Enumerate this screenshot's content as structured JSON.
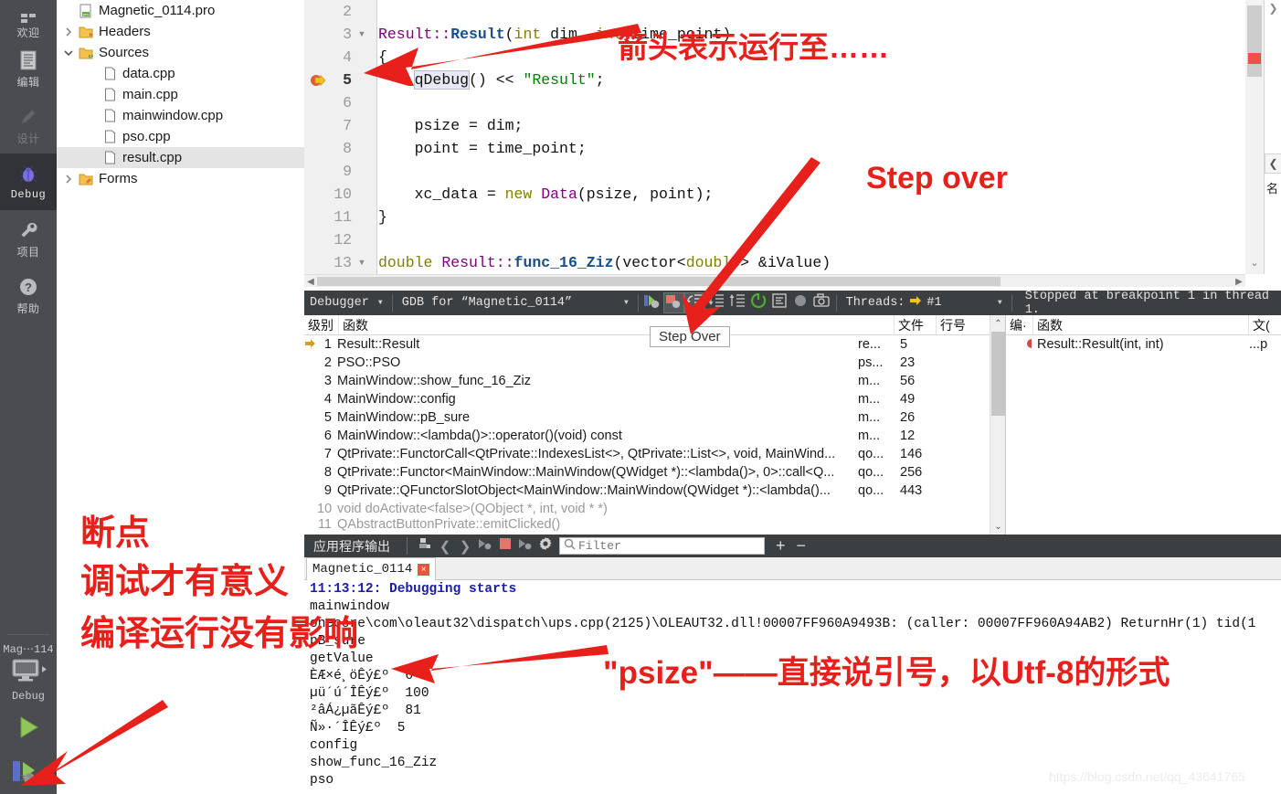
{
  "modebar": {
    "items": [
      {
        "label": "欢迎",
        "icon": "welcome-icon",
        "state": "normal"
      },
      {
        "label": "编辑",
        "icon": "edit-document-icon",
        "state": "normal"
      },
      {
        "label": "设计",
        "icon": "pencil-design-icon",
        "state": "disabled"
      },
      {
        "label": "Debug",
        "icon": "bug-icon",
        "state": "active"
      },
      {
        "label": "项目",
        "icon": "wrench-icon",
        "state": "normal"
      },
      {
        "label": "帮助",
        "icon": "question-help-icon",
        "state": "normal"
      }
    ],
    "kit_name": "Mag⋯114",
    "kit_config": "Debug",
    "run_button": "run-icon",
    "debug_button": "start-debugging-icon"
  },
  "tree": {
    "items": [
      {
        "label": "Magnetic_0114.pro",
        "indent": 1,
        "twisty": "",
        "icon": "pro-file-icon",
        "selected": false
      },
      {
        "label": "Headers",
        "indent": 1,
        "twisty": "collapsed",
        "icon": "headers-folder-icon",
        "selected": false
      },
      {
        "label": "Sources",
        "indent": 1,
        "twisty": "expanded",
        "icon": "sources-folder-icon",
        "selected": false
      },
      {
        "label": "data.cpp",
        "indent": 2,
        "twisty": "",
        "icon": "cpp-file-icon",
        "selected": false
      },
      {
        "label": "main.cpp",
        "indent": 2,
        "twisty": "",
        "icon": "cpp-file-icon",
        "selected": false
      },
      {
        "label": "mainwindow.cpp",
        "indent": 2,
        "twisty": "",
        "icon": "cpp-file-icon",
        "selected": false
      },
      {
        "label": "pso.cpp",
        "indent": 2,
        "twisty": "",
        "icon": "cpp-file-icon",
        "selected": false
      },
      {
        "label": "result.cpp",
        "indent": 2,
        "twisty": "",
        "icon": "cpp-file-icon",
        "selected": true
      },
      {
        "label": "Forms",
        "indent": 1,
        "twisty": "collapsed",
        "icon": "forms-folder-icon",
        "selected": false
      }
    ]
  },
  "editor": {
    "current_line": 5,
    "current_word": "qDebug",
    "lines": [
      {
        "n": "2",
        "fold": "",
        "marker": "",
        "tokens": []
      },
      {
        "n": "3",
        "fold": "down",
        "marker": "",
        "tokens": [
          {
            "t": "Result::",
            "c": "type"
          },
          {
            "t": "Result",
            "c": "fn"
          },
          {
            "t": "(",
            "c": "plain"
          },
          {
            "t": "int",
            "c": "key"
          },
          {
            "t": " dim, ",
            "c": "plain"
          },
          {
            "t": "int",
            "c": "key"
          },
          {
            "t": " time_point)",
            "c": "plain"
          }
        ]
      },
      {
        "n": "4",
        "fold": "",
        "marker": "",
        "tokens": [
          {
            "t": "{",
            "c": "plain"
          }
        ]
      },
      {
        "n": "5",
        "fold": "",
        "marker": "current",
        "tokens": [
          {
            "t": "    ",
            "c": "plain"
          },
          {
            "t": "qDebug",
            "c": "cur"
          },
          {
            "t": "() << ",
            "c": "plain"
          },
          {
            "t": "\"Result\"",
            "c": "str"
          },
          {
            "t": ";",
            "c": "plain"
          }
        ]
      },
      {
        "n": "6",
        "fold": "",
        "marker": "",
        "tokens": []
      },
      {
        "n": "7",
        "fold": "",
        "marker": "",
        "tokens": [
          {
            "t": "    psize = dim;",
            "c": "plain"
          }
        ]
      },
      {
        "n": "8",
        "fold": "",
        "marker": "",
        "tokens": [
          {
            "t": "    point = time_point;",
            "c": "plain"
          }
        ]
      },
      {
        "n": "9",
        "fold": "",
        "marker": "",
        "tokens": []
      },
      {
        "n": "10",
        "fold": "",
        "marker": "",
        "tokens": [
          {
            "t": "    xc_data = ",
            "c": "plain"
          },
          {
            "t": "new",
            "c": "key"
          },
          {
            "t": " ",
            "c": "plain"
          },
          {
            "t": "Data",
            "c": "type"
          },
          {
            "t": "(psize, point);",
            "c": "plain"
          }
        ]
      },
      {
        "n": "11",
        "fold": "",
        "marker": "",
        "tokens": [
          {
            "t": "}",
            "c": "plain"
          }
        ]
      },
      {
        "n": "12",
        "fold": "",
        "marker": "",
        "tokens": []
      },
      {
        "n": "13",
        "fold": "down",
        "marker": "",
        "tokens": [
          {
            "t": "double",
            "c": "key"
          },
          {
            "t": " ",
            "c": "plain"
          },
          {
            "t": "Result::",
            "c": "type"
          },
          {
            "t": "func_16_Ziz",
            "c": "fn"
          },
          {
            "t": "(",
            "c": "plain"
          },
          {
            "t": "vector",
            "c": "plain"
          },
          {
            "t": "<",
            "c": "plain"
          },
          {
            "t": "double",
            "c": "key"
          },
          {
            "t": "> &iValue)",
            "c": "plain"
          }
        ]
      }
    ]
  },
  "rightbar": {
    "label": "名"
  },
  "debugbar": {
    "mode_label": "Debugger",
    "engine_label": "GDB for “Magnetic_0114”",
    "threads_label": "Threads:",
    "thread_value": "#1",
    "status": "Stopped at breakpoint 1 in thread 1.",
    "buttons": [
      {
        "name": "continue-debug-icon",
        "active": false
      },
      {
        "name": "interrupt-debug-icon",
        "active": true
      },
      {
        "name": "step-over-icon",
        "active": true
      },
      {
        "name": "step-into-icon",
        "active": false
      },
      {
        "name": "step-out-icon",
        "active": false
      },
      {
        "name": "stop-debugger-icon",
        "active": false
      },
      {
        "name": "toggle-disassembly-icon",
        "active": false
      },
      {
        "name": "reset-debugger-icon",
        "active": false
      },
      {
        "name": "snapshot-icon",
        "active": false
      }
    ]
  },
  "tooltip": {
    "text": "Step Over"
  },
  "stack": {
    "headers": {
      "level": "级别",
      "function": "函数",
      "file": "文件",
      "line": "行号"
    },
    "rows": [
      {
        "marker": true,
        "level": "1",
        "fn": "Result::Result",
        "file": "re...",
        "line": "5",
        "faded": false
      },
      {
        "marker": false,
        "level": "2",
        "fn": "PSO::PSO",
        "file": "ps...",
        "line": "23",
        "faded": false
      },
      {
        "marker": false,
        "level": "3",
        "fn": "MainWindow::show_func_16_Ziz",
        "file": "m...",
        "line": "56",
        "faded": false
      },
      {
        "marker": false,
        "level": "4",
        "fn": "MainWindow::config",
        "file": "m...",
        "line": "49",
        "faded": false
      },
      {
        "marker": false,
        "level": "5",
        "fn": "MainWindow::pB_sure",
        "file": "m...",
        "line": "26",
        "faded": false
      },
      {
        "marker": false,
        "level": "6",
        "fn": "MainWindow::<lambda()>::operator()(void) const",
        "file": "m...",
        "line": "12",
        "faded": false
      },
      {
        "marker": false,
        "level": "7",
        "fn": "QtPrivate::FunctorCall<QtPrivate::IndexesList<>, QtPrivate::List<>, void, MainWind...",
        "file": "qo...",
        "line": "146",
        "faded": false
      },
      {
        "marker": false,
        "level": "8",
        "fn": "QtPrivate::Functor<MainWindow::MainWindow(QWidget *)::<lambda()>, 0>::call<Q...",
        "file": "qo...",
        "line": "256",
        "faded": false
      },
      {
        "marker": false,
        "level": "9",
        "fn": "QtPrivate::QFunctorSlotObject<MainWindow::MainWindow(QWidget *)::<lambda()...",
        "file": "qo...",
        "line": "443",
        "faded": false
      },
      {
        "marker": false,
        "level": "10",
        "fn": "void doActivate<false>(QObject *, int, void * *)",
        "file": "",
        "line": "",
        "faded": true
      },
      {
        "marker": false,
        "level": "11",
        "fn": "QAbstractButtonPrivate::emitClicked()",
        "file": "",
        "line": "",
        "faded": true
      }
    ]
  },
  "breakpoints": {
    "headers": {
      "number": "编·",
      "function": "函数",
      "file": "文("
    },
    "rows": [
      {
        "fn": "Result::Result(int, int)",
        "file": "...p"
      }
    ]
  },
  "appoutput": {
    "title": "应用程序输出",
    "icons": [
      "clear-output-icon",
      "prev-item-icon",
      "next-item-icon",
      "attach-debugger-icon",
      "stop-icon",
      "run-icon",
      "settings-gear-icon"
    ],
    "filter_placeholder": "Filter",
    "filter_value": "",
    "add_label": "+",
    "remove_label": "−",
    "tab": {
      "label": "Magnetic_0114",
      "close": "×"
    },
    "lines": [
      {
        "text": "11:13:12: Debugging starts",
        "style": "hdr"
      },
      {
        "text": "mainwindow",
        "style": "normal"
      },
      {
        "text": "onecore\\com\\oleaut32\\dispatch\\ups.cpp(2125)\\OLEAUT32.dll!00007FF960A9493B: (caller: 00007FF960A94AB2) ReturnHr(1) tid(1",
        "style": "normal"
      },
      {
        "text": "pB_sure",
        "style": "normal"
      },
      {
        "text": "getValue",
        "style": "normal"
      },
      {
        "text": "ÈÆ×é¸öÊý£º  6",
        "style": "normal"
      },
      {
        "text": "µü´ú´ÎÊý£º  100",
        "style": "normal"
      },
      {
        "text": "²âÁ¿µãÊý£º  81",
        "style": "normal"
      },
      {
        "text": "Ñ»·´ÎÊý£º  5",
        "style": "normal"
      },
      {
        "text": "config",
        "style": "normal"
      },
      {
        "text": "show_func_16_Ziz",
        "style": "normal"
      },
      {
        "text": "pso",
        "style": "normal"
      }
    ]
  },
  "annotations": {
    "arrow_note": "箭头表示运行至……",
    "step_over_note": "Step over",
    "breakpoint_note_1": "断点",
    "breakpoint_note_2": "调试才有意义",
    "breakpoint_note_3": "编译运行没有影响",
    "psize_note": "\"psize\"——直接说引号，以Utf-8的形式",
    "accent_color": "#e8201b"
  },
  "watermark": {
    "text": "https://blog.csdn.net/qq_43641765"
  }
}
